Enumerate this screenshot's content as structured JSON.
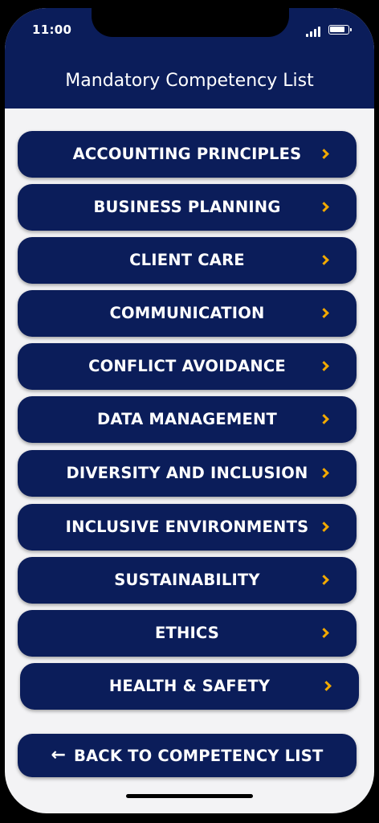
{
  "status_bar": {
    "time": "11:00"
  },
  "header": {
    "title": "Mandatory Competency List"
  },
  "items": [
    {
      "label": "ACCOUNTING PRINCIPLES"
    },
    {
      "label": "BUSINESS PLANNING"
    },
    {
      "label": "CLIENT CARE"
    },
    {
      "label": "COMMUNICATION"
    },
    {
      "label": "CONFLICT AVOIDANCE"
    },
    {
      "label": "DATA MANAGEMENT"
    },
    {
      "label": "DIVERSITY AND INCLUSION"
    },
    {
      "label": "INCLUSIVE ENVIRONMENTS"
    },
    {
      "label": "SUSTAINABILITY"
    },
    {
      "label": "ETHICS"
    },
    {
      "label": "HEALTH & SAFETY"
    }
  ],
  "back_button": {
    "label": "BACK TO COMPETENCY LIST",
    "icon": "←"
  },
  "colors": {
    "primary": "#0b1d5a",
    "accent": "#f2a900",
    "background": "#f3f3f5"
  }
}
